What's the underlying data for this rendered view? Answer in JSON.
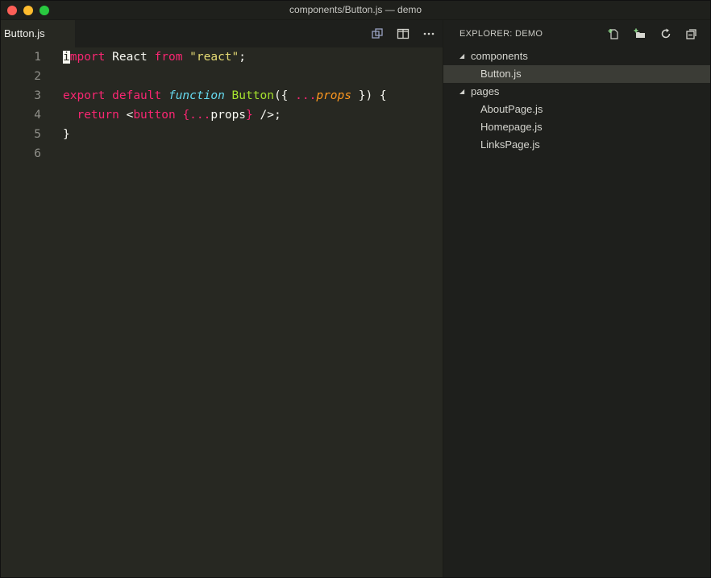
{
  "window": {
    "title": "components/Button.js — demo"
  },
  "editor": {
    "tab_label": "Button.js",
    "actions": [
      "open-changes-icon",
      "split-editor-icon",
      "more-actions-icon"
    ],
    "line_numbers": [
      "1",
      "2",
      "3",
      "4",
      "5",
      "6"
    ],
    "lines": [
      [
        {
          "t": "i",
          "c": "cursor"
        },
        {
          "t": "mport",
          "c": "kw"
        },
        {
          "t": " React ",
          "c": "plain"
        },
        {
          "t": "from",
          "c": "kw"
        },
        {
          "t": " ",
          "c": "plain"
        },
        {
          "t": "\"react\"",
          "c": "str"
        },
        {
          "t": ";",
          "c": "plain"
        }
      ],
      [],
      [
        {
          "t": "export",
          "c": "kw"
        },
        {
          "t": " ",
          "c": "plain"
        },
        {
          "t": "default",
          "c": "kw"
        },
        {
          "t": " ",
          "c": "plain"
        },
        {
          "t": "function",
          "c": "type"
        },
        {
          "t": " ",
          "c": "plain"
        },
        {
          "t": "Button",
          "c": "fn"
        },
        {
          "t": "({ ",
          "c": "plain"
        },
        {
          "t": "...",
          "c": "kw"
        },
        {
          "t": "props",
          "c": "param"
        },
        {
          "t": " }) {",
          "c": "plain"
        }
      ],
      [
        {
          "t": "  ",
          "c": "plain"
        },
        {
          "t": "return",
          "c": "kw"
        },
        {
          "t": " <",
          "c": "plain"
        },
        {
          "t": "button",
          "c": "kw"
        },
        {
          "t": " ",
          "c": "plain"
        },
        {
          "t": "{...",
          "c": "kw"
        },
        {
          "t": "props",
          "c": "plain"
        },
        {
          "t": "}",
          "c": "kw"
        },
        {
          "t": " />;",
          "c": "plain"
        }
      ],
      [
        {
          "t": "}",
          "c": "plain"
        }
      ],
      []
    ]
  },
  "explorer": {
    "title": "EXPLORER: DEMO",
    "actions": [
      "new-file-icon",
      "new-folder-icon",
      "refresh-icon",
      "collapse-all-icon"
    ],
    "items": [
      {
        "label": "components",
        "type": "folder",
        "expanded": true
      },
      {
        "label": "Button.js",
        "type": "file",
        "selected": true
      },
      {
        "label": "pages",
        "type": "folder",
        "expanded": true
      },
      {
        "label": "AboutPage.js",
        "type": "file"
      },
      {
        "label": "Homepage.js",
        "type": "file"
      },
      {
        "label": "LinksPage.js",
        "type": "file"
      }
    ]
  },
  "colors": {
    "background": "#272822",
    "sidebar": "#1e1f1c",
    "keyword": "#f92672",
    "string": "#e6db74",
    "function": "#a6e22e",
    "storage": "#66d9ef",
    "parameter": "#fd971f"
  }
}
